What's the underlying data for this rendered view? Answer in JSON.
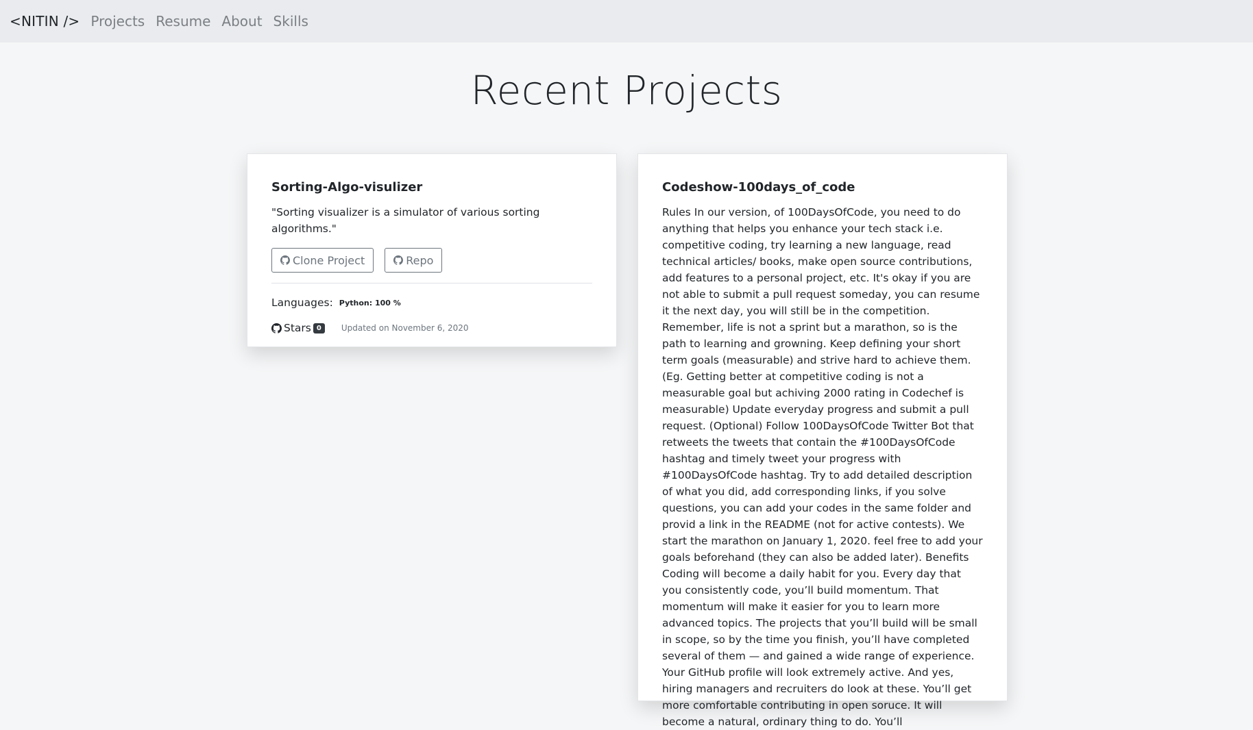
{
  "navbar": {
    "brand": "<NITIN />",
    "links": [
      "Projects",
      "Resume",
      "About",
      "Skills"
    ]
  },
  "page_title": "Recent Projects",
  "projects": [
    {
      "title": "Sorting-Algo-visulizer",
      "description": "\"Sorting visualizer is a simulator of various sorting algorithms.\"",
      "clone_label": "Clone Project",
      "repo_label": "Repo",
      "languages_label": "Languages:",
      "language_badge": "Python: 100 %",
      "stars_label": "Stars",
      "stars_count": "0",
      "updated": "Updated on November 6, 2020"
    },
    {
      "title": "Codeshow-100days_of_code",
      "description": "Rules In our version, of 100DaysOfCode, you need to do anything that helps you enhance your tech stack i.e. competitive coding, try learning a new language, read technical articles/ books, make open source contributions, add features to a personal project, etc. It's okay if you are not able to submit a pull request someday, you can resume it the next day, you will still be in the competition. Remember, life is not a sprint but a marathon, so is the path to learning and growning. Keep defining your short term goals (measurable) and strive hard to achieve them. (Eg. Getting better at competitive coding is not a measurable goal but achiving 2000 rating in Codechef is measurable) Update everyday progress and submit a pull request. (Optional) Follow 100DaysOfCode Twitter Bot that retweets the tweets that contain the #100DaysOfCode hashtag and timely tweet your progress with #100DaysOfCode hashtag. Try to add detailed description of what you did, add corresponding links, if you solve questions, you can add your codes in the same folder and provid a link in the README (not for active contests). We start the marathon on January 1, 2020. feel free to add your goals beforehand (they can also be added later). Benefits Coding will become a daily habit for you. Every day that you consistently code, you’ll build momentum. That momentum will make it easier for you to learn more advanced topics. The projects that you’ll build will be small in scope, so by the time you finish, you’ll have completed several of them — and gained a wide range of experience. Your GitHub profile will look extremely active. And yes, hiring managers and recruiters do look at these. You’ll get more comfortable contributing in open soruce. It will become a natural, ordinary thing to do. You’ll"
    }
  ],
  "icons": {
    "github": "github-icon"
  }
}
